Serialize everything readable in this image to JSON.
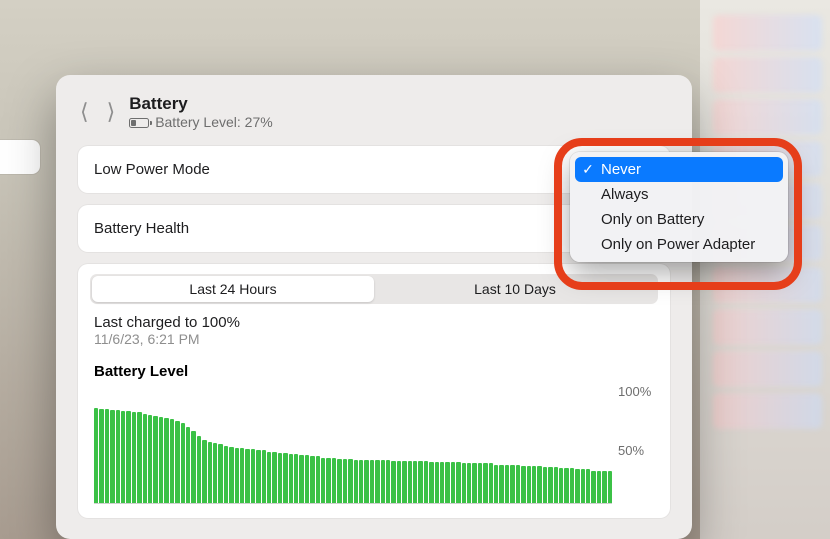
{
  "header": {
    "title": "Battery",
    "subtitle": "Battery Level: 27%"
  },
  "rows": {
    "low_power_mode": "Low Power Mode",
    "battery_health": "Battery Health"
  },
  "segmented": {
    "tab1": "Last 24 Hours",
    "tab2": "Last 10 Days"
  },
  "charge_info": {
    "title": "Last charged to 100%",
    "subtitle": "11/6/23, 6:21 PM"
  },
  "chart": {
    "title": "Battery Level",
    "y_top": "100%",
    "y_mid": "50%"
  },
  "popup": {
    "options": [
      "Never",
      "Always",
      "Only on Battery",
      "Only on Power Adapter"
    ],
    "selected_index": 0
  },
  "chart_data": {
    "type": "bar",
    "title": "Battery Level",
    "ylabel": "%",
    "ylim": [
      0,
      100
    ],
    "values": [
      80,
      79,
      79,
      78,
      78,
      77,
      77,
      76,
      76,
      75,
      74,
      73,
      72,
      71,
      70,
      69,
      67,
      64,
      60,
      56,
      53,
      51,
      50,
      49,
      48,
      47,
      46,
      46,
      45,
      45,
      44,
      44,
      43,
      43,
      42,
      42,
      41,
      41,
      40,
      40,
      39,
      39,
      38,
      38,
      38,
      37,
      37,
      37,
      36,
      36,
      36,
      36,
      36,
      36,
      36,
      35,
      35,
      35,
      35,
      35,
      35,
      35,
      34,
      34,
      34,
      34,
      34,
      34,
      33,
      33,
      33,
      33,
      33,
      33,
      32,
      32,
      32,
      32,
      32,
      31,
      31,
      31,
      31,
      30,
      30,
      30,
      29,
      29,
      29,
      28,
      28,
      28,
      27,
      27,
      27,
      27
    ]
  }
}
